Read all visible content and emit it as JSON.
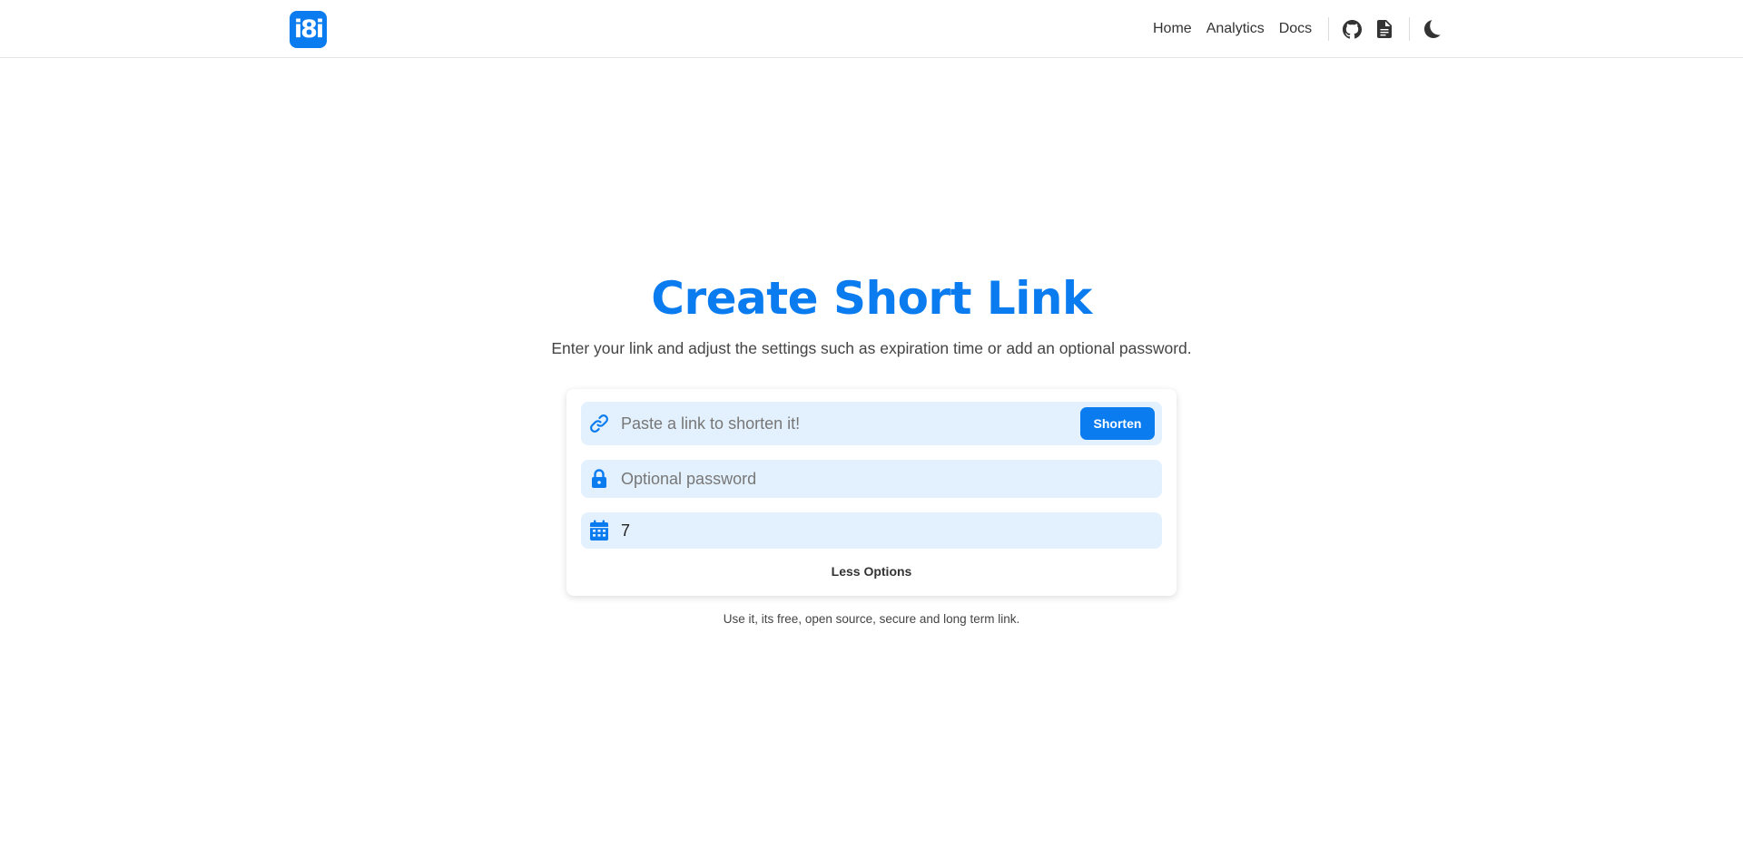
{
  "brand": {
    "logo_text": "i8i",
    "accent": "#0a7cf0"
  },
  "nav": {
    "links": [
      "Home",
      "Analytics",
      "Docs"
    ],
    "icons": [
      "github-icon",
      "document-icon",
      "moon-icon"
    ]
  },
  "hero": {
    "title": "Create Short Link",
    "subtitle": "Enter your link and adjust the settings such as expiration time or add an optional password."
  },
  "form": {
    "url_placeholder": "Paste a link to shorten it!",
    "shorten_label": "Shorten",
    "password_placeholder": "Optional password",
    "expiration_value": "7",
    "less_options_label": "Less Options"
  },
  "footer_note": "Use it, its free, open source, secure and long term link."
}
